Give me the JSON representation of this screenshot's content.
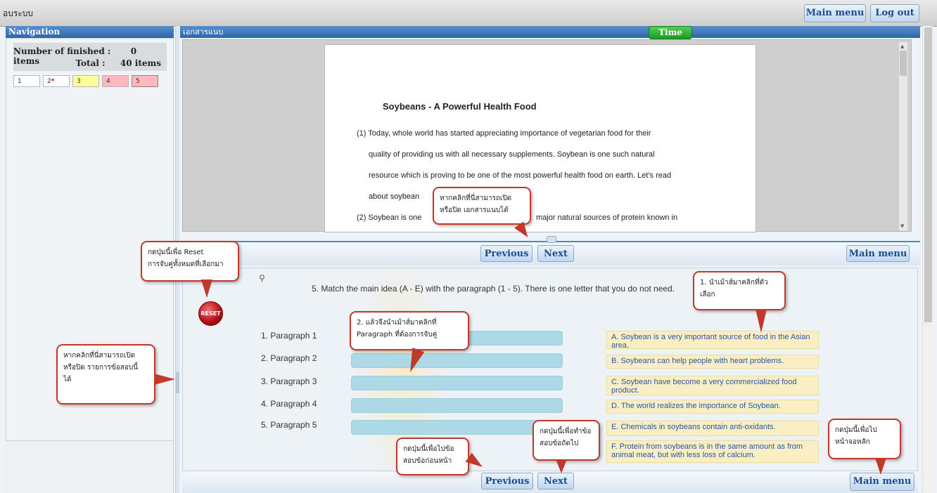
{
  "topbar": {
    "title": "อบระบบ",
    "main_menu": "Main menu",
    "logout": "Log out"
  },
  "nav": {
    "header": "Navigation",
    "finished_label": "Number of finished :",
    "finished_value": "0 items",
    "total_label": "Total :",
    "total_value": "40 items",
    "items": [
      {
        "label": "1",
        "state": "unanswered",
        "color": "#ffffff"
      },
      {
        "label": "2",
        "state": "flagged",
        "color": "#ffffff"
      },
      {
        "label": "3",
        "state": "answered",
        "color": "#ffff99"
      },
      {
        "label": "4",
        "state": "current",
        "color": "#ffb8bc"
      },
      {
        "label": "5",
        "state": "current",
        "color": "#ffb8bc"
      }
    ]
  },
  "document": {
    "header": "เอกสารแนบ",
    "time_label": "Time",
    "title": "Soybeans - A Powerful Health Food",
    "lines": [
      "(1) Today, whole world has started appreciating importance of vegetarian food for their",
      "quality of providing us with all necessary supplements. Soybean is one such natural",
      "resource which is proving to be one of the most powerful health food on earth. Let's read",
      "about soybean",
      "(2) Soybean is one",
      "major natural sources of protein known in"
    ]
  },
  "controls": {
    "previous": "Previous",
    "next": "Next",
    "main_menu": "Main menu",
    "reset": "RESET"
  },
  "quiz": {
    "question": "5.  Match the main idea (A - E) with the paragraph (1 - 5). There is one letter that you do not need.",
    "paragraphs": [
      "1.  Paragraph 1",
      "2.  Paragraph 2",
      "3.  Paragraph 3",
      "4.  Paragraph 4",
      "5.  Paragraph 5"
    ],
    "answers": [
      "A. Soybean is a very important source of food in the Asian area.",
      "B. Soybeans can help people with heart problems.",
      "C. Soybean have become a very commercialized food product.",
      "D. The world realizes the importance of Soybean.",
      "E. Chemicals in soybeans contain anti-oxidants.",
      "F. Protein from soybeans is in the same amount as from animal meat, but with less loss of calcium."
    ]
  },
  "callouts": {
    "doc_toggle": [
      "หากคลิกที่นี่สามารถเปิด",
      "หรือปิด เอกสารแนบได้"
    ],
    "reset": [
      "กดปุ่มนี้เพื่อ Reset",
      "การจับคู่ทั้งหมดที่เลือกมา"
    ],
    "step1": [
      "1. นำเม้าส์มาคลิกที่ตัว",
      "เลือก"
    ],
    "step2": [
      "2. แล้วจึงนำเม้าส์มาคลิกที่",
      "Paragraph ที่ต้องการจับคู่"
    ],
    "nav_toggle": [
      "หากคลิกที่นี่สามารถเปิด",
      "หรือปิด รายการข้อสอบนี้",
      "ได้"
    ],
    "next": [
      "กดปุ่มนี้เพื่อทำข้อ",
      "สอบข้อถัดไป"
    ],
    "previous": [
      "กดปุ่มนี้เพื่อไปข้อ",
      "สอบข้อก่อนหน้า"
    ],
    "main_menu": [
      "กดปุ่มนี้เพื่อไป",
      "หน้าจอหลัก"
    ]
  }
}
